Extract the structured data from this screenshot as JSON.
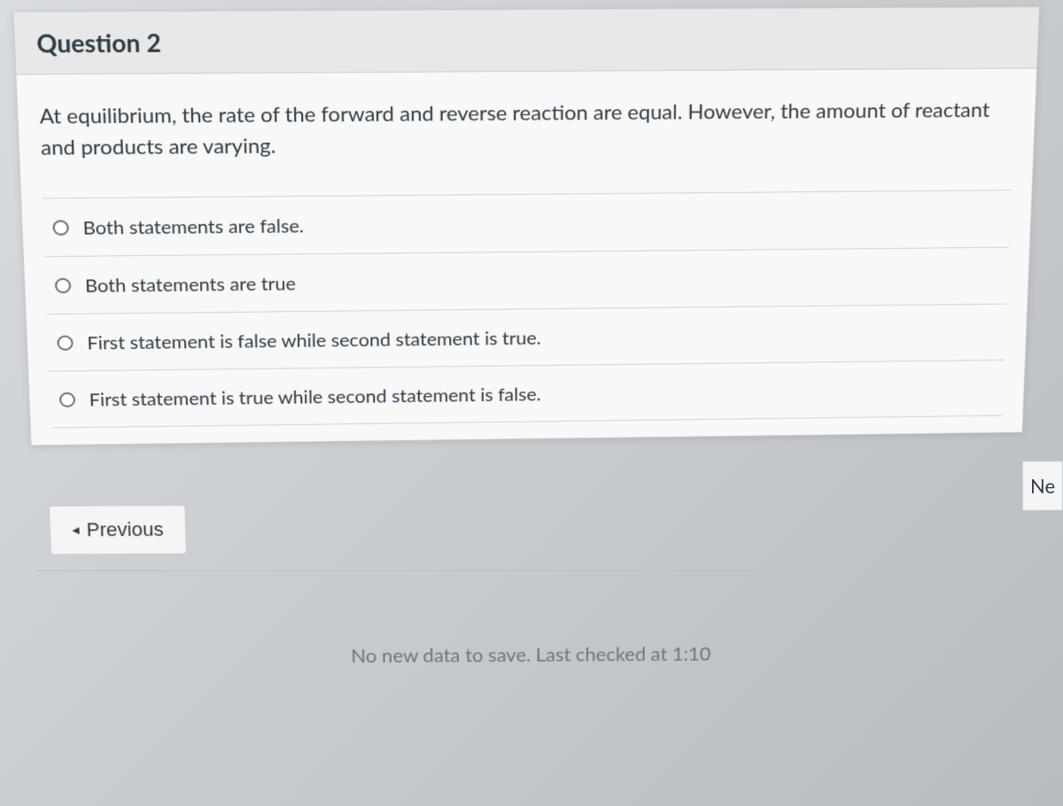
{
  "question": {
    "title": "Question 2",
    "text": "At equilibrium, the rate of the forward and reverse reaction are equal. However, the amount of reactant and products are varying.",
    "options": [
      "Both statements are false.",
      "Both statements are true",
      "First statement is false while second statement is true.",
      "First statement is true while second statement is false."
    ]
  },
  "nav": {
    "previous_label": "Previous",
    "next_label": "Ne"
  },
  "status": {
    "save_message": "No new data to save. Last checked at 1:10"
  }
}
